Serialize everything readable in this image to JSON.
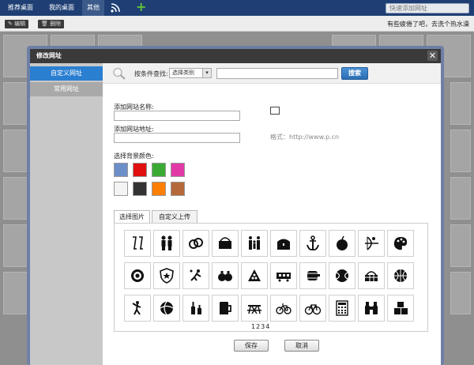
{
  "topnav": {
    "tabs": [
      "推荐桌面",
      "我的桌面",
      "其他"
    ],
    "active_tab": 2,
    "quick_placeholder": "快速添加网址"
  },
  "toolbar": {
    "edit_label": "编辑",
    "delete_label": "删除",
    "hint": "有些疲倦了吧，去洗个热水澡"
  },
  "modal": {
    "title": "修改网址",
    "close_glyph": "✕",
    "sidebar": [
      "自定义网址",
      "常用网址"
    ],
    "search": {
      "label": "按条件查找:",
      "select_value": "选择类别",
      "button": "搜索"
    },
    "form": {
      "name_label": "添加网站名称:",
      "url_label": "添加网站地址:",
      "format_hint": "格式：http://www.p.cn",
      "color_label": "选择背景颜色:"
    },
    "colors": [
      "#6d8fc9",
      "#e01010",
      "#3aaa35",
      "#e23aa6",
      "#f4f4f4",
      "#333333",
      "#ff7f00",
      "#b5693a"
    ],
    "tabs": [
      "选择图片",
      "自定义上传"
    ],
    "icons": [
      "champagne-icon",
      "couple-icon",
      "rings-icon",
      "basket-icon",
      "family-icon",
      "treasure-chest-icon",
      "anchor-icon",
      "apple-icon",
      "archery-icon",
      "palette-icon",
      "at-sign-icon",
      "police-badge-icon",
      "badminton-icon",
      "money-bags-icon",
      "billiards-icon",
      "train-car-icon",
      "keg-icon",
      "tennis-ball-icon",
      "picnic-basket-icon",
      "basketball-icon",
      "baseball-player-icon",
      "beach-ball-icon",
      "bottles-icon",
      "beer-mug-icon",
      "picnic-table-icon",
      "bicycle-icon",
      "racing-bike-icon",
      "calculator-icon",
      "binoculars-icon",
      "blocks-icon"
    ],
    "pages": "1234",
    "save_label": "保存",
    "cancel_label": "取消"
  }
}
